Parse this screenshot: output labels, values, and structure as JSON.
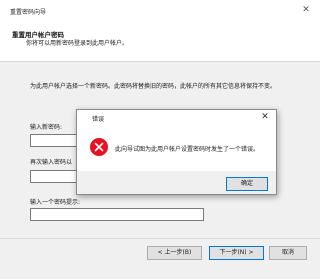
{
  "wizard": {
    "title": "重置密码向导",
    "close_glyph": "✕",
    "header_title": "重置用户帐户密码",
    "header_subtitle": "你将可以用新密码登录到此用户帐户。",
    "description": "为此用户帐户选择一个新密码。此密码将替换旧的密码，此帐户的所有其它信息将保持不变。",
    "new_password_label": "输入新密码:",
    "confirm_password_label": "再次输入密码以",
    "hint_label": "输入一个密码提示:",
    "new_password_value": "",
    "confirm_password_value": "",
    "hint_value": "",
    "back_label": "< 上一步(B)",
    "next_label": "下一步(N) >",
    "cancel_label": "取消"
  },
  "error_dialog": {
    "title": "错误",
    "close_glyph": "✕",
    "message": "此向导试图为此用户帐户设置密码时发生了一个错误。",
    "ok_label": "确定"
  },
  "colors": {
    "error_red": "#e81123",
    "accent_blue": "#0078d7"
  }
}
